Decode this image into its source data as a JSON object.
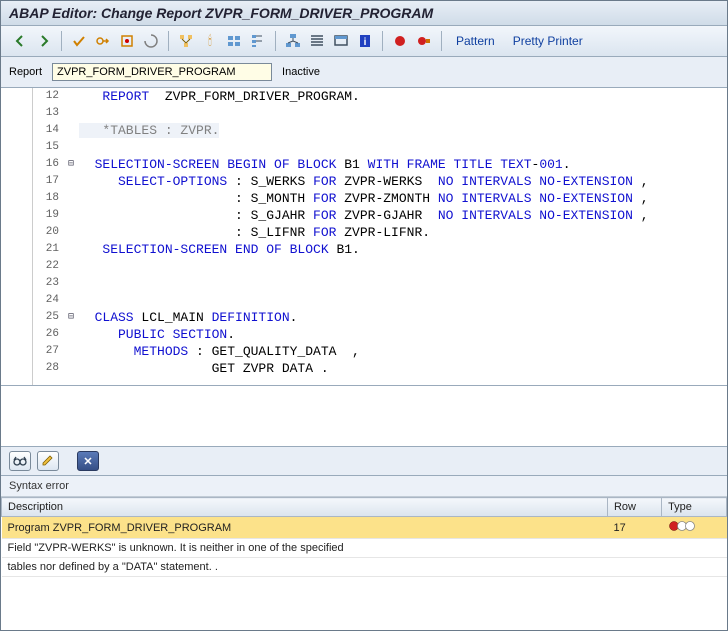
{
  "title": "ABAP Editor: Change Report ZVPR_FORM_DRIVER_PROGRAM",
  "toolbar_links": {
    "pattern": "Pattern",
    "pretty": "Pretty Printer"
  },
  "report": {
    "label": "Report",
    "value": "ZVPR_FORM_DRIVER_PROGRAM",
    "status": "Inactive"
  },
  "code": {
    "start": 12,
    "lines": [
      {
        "n": 12,
        "fold": "",
        "segs": [
          [
            "kw",
            "   REPORT"
          ],
          [
            "txt",
            "  ZVPR_FORM_DRIVER_PROGRAM."
          ]
        ]
      },
      {
        "n": 13,
        "fold": "",
        "segs": []
      },
      {
        "n": 14,
        "fold": "",
        "segs": [
          [
            "cmt",
            "   *TABLES : ZVPR."
          ]
        ]
      },
      {
        "n": 15,
        "fold": "",
        "segs": []
      },
      {
        "n": 16,
        "fold": "⊟",
        "segs": [
          [
            "kw",
            "  SELECTION-SCREEN BEGIN OF BLOCK"
          ],
          [
            "txt",
            " B1 "
          ],
          [
            "kw",
            "WITH FRAME TITLE TEXT"
          ],
          [
            "txt",
            "-"
          ],
          [
            "num",
            "001"
          ],
          [
            "txt",
            "."
          ]
        ]
      },
      {
        "n": 17,
        "fold": "",
        "segs": [
          [
            "kw",
            "     SELECT-OPTIONS"
          ],
          [
            "txt",
            " : S_WERKS "
          ],
          [
            "kw",
            "FOR"
          ],
          [
            "txt",
            " ZVPR-WERKS  "
          ],
          [
            "kw",
            "NO INTERVALS NO-EXTENSION"
          ],
          [
            "txt",
            " ,"
          ]
        ]
      },
      {
        "n": 18,
        "fold": "",
        "segs": [
          [
            "txt",
            "                    : S_MONTH "
          ],
          [
            "kw",
            "FOR"
          ],
          [
            "txt",
            " ZVPR-ZMONTH "
          ],
          [
            "kw",
            "NO INTERVALS NO-EXTENSION"
          ],
          [
            "txt",
            " ,"
          ]
        ]
      },
      {
        "n": 19,
        "fold": "",
        "segs": [
          [
            "txt",
            "                    : S_GJAHR "
          ],
          [
            "kw",
            "FOR"
          ],
          [
            "txt",
            " ZVPR-GJAHR  "
          ],
          [
            "kw",
            "NO INTERVALS NO-EXTENSION"
          ],
          [
            "txt",
            " ,"
          ]
        ]
      },
      {
        "n": 20,
        "fold": "",
        "segs": [
          [
            "txt",
            "                    : S_LIFNR "
          ],
          [
            "kw",
            "FOR"
          ],
          [
            "txt",
            " ZVPR-LIFNR."
          ]
        ]
      },
      {
        "n": 21,
        "fold": "",
        "segs": [
          [
            "kw",
            "   SELECTION-SCREEN END OF BLOCK"
          ],
          [
            "txt",
            " B1."
          ]
        ]
      },
      {
        "n": 22,
        "fold": "",
        "segs": []
      },
      {
        "n": 23,
        "fold": "",
        "segs": []
      },
      {
        "n": 24,
        "fold": "",
        "segs": []
      },
      {
        "n": 25,
        "fold": "⊟",
        "segs": [
          [
            "kw",
            "  CLASS"
          ],
          [
            "txt",
            " LCL_MAIN "
          ],
          [
            "kw",
            "DEFINITION"
          ],
          [
            "txt",
            "."
          ]
        ]
      },
      {
        "n": 26,
        "fold": "",
        "segs": [
          [
            "kw",
            "     PUBLIC SECTION"
          ],
          [
            "txt",
            "."
          ]
        ]
      },
      {
        "n": 27,
        "fold": "",
        "segs": [
          [
            "kw",
            "       METHODS"
          ],
          [
            "txt",
            " : GET_QUALITY_DATA  ,"
          ]
        ]
      },
      {
        "n": 28,
        "fold": "",
        "segs": [
          [
            "txt",
            "                 GET ZVPR DATA ."
          ]
        ]
      }
    ]
  },
  "error_panel": {
    "caption": "Syntax error",
    "headers": {
      "desc": "Description",
      "row": "Row",
      "type": "Type"
    },
    "row1": {
      "desc": "Program ZVPR_FORM_DRIVER_PROGRAM",
      "row": "17"
    },
    "row2": {
      "desc": "Field \"ZVPR-WERKS\" is unknown. It is neither in one of the specified"
    },
    "row3": {
      "desc": "tables nor defined by a \"DATA\" statement. ."
    }
  }
}
